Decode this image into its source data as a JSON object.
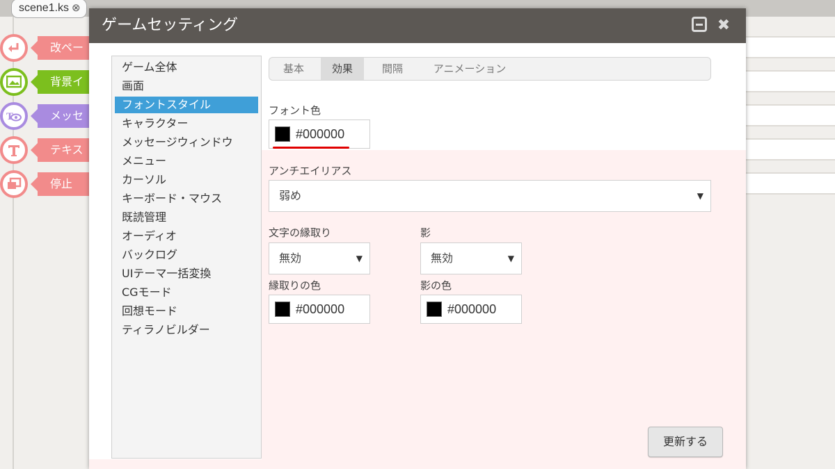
{
  "editor": {
    "tab_label": "scene1.ks",
    "tab_close": "⊗",
    "blocks": [
      {
        "label": "改ペー",
        "color": "#f28b8b",
        "icon": "return-arrow-icon"
      },
      {
        "label": "背景イ",
        "color": "#7cbf1e",
        "icon": "background-image-icon"
      },
      {
        "label": "メッセ",
        "color": "#a98be0",
        "icon": "message-eye-icon"
      },
      {
        "label": "テキス",
        "color": "#f28b8b",
        "icon": "text-t-icon"
      },
      {
        "label": "停止",
        "color": "#f28b8b",
        "icon": "window-stop-icon"
      }
    ]
  },
  "dialog": {
    "title": "ゲームセッティング",
    "minimize_icon": "minimize-icon",
    "close_icon": "close-icon",
    "close_glyph": "✖",
    "sidebar": {
      "items": [
        "ゲーム全体",
        "画面",
        "フォントスタイル",
        "キャラクター",
        "メッセージウィンドウ",
        "メニュー",
        "カーソル",
        "キーボード・マウス",
        "既読管理",
        "オーディオ",
        "バックログ",
        "UIテーマ一括変換",
        "CGモード",
        "回想モード",
        "ティラノビルダー"
      ],
      "active_index": 2
    },
    "tabs": {
      "items": [
        "基本",
        "効果",
        "間隔",
        "アニメーション"
      ],
      "active_index": 1
    },
    "font_color": {
      "label": "フォント色",
      "value": "#000000",
      "swatch": "#000000"
    },
    "antialias": {
      "label": "アンチエイリアス",
      "value": "弱め"
    },
    "outline": {
      "label": "文字の縁取り",
      "value": "無効"
    },
    "shadow": {
      "label": "影",
      "value": "無効"
    },
    "outline_color": {
      "label": "縁取りの色",
      "value": "#000000",
      "swatch": "#000000"
    },
    "shadow_color": {
      "label": "影の色",
      "value": "#000000",
      "swatch": "#000000"
    },
    "update_button": "更新する",
    "select_arrow": "▼"
  }
}
